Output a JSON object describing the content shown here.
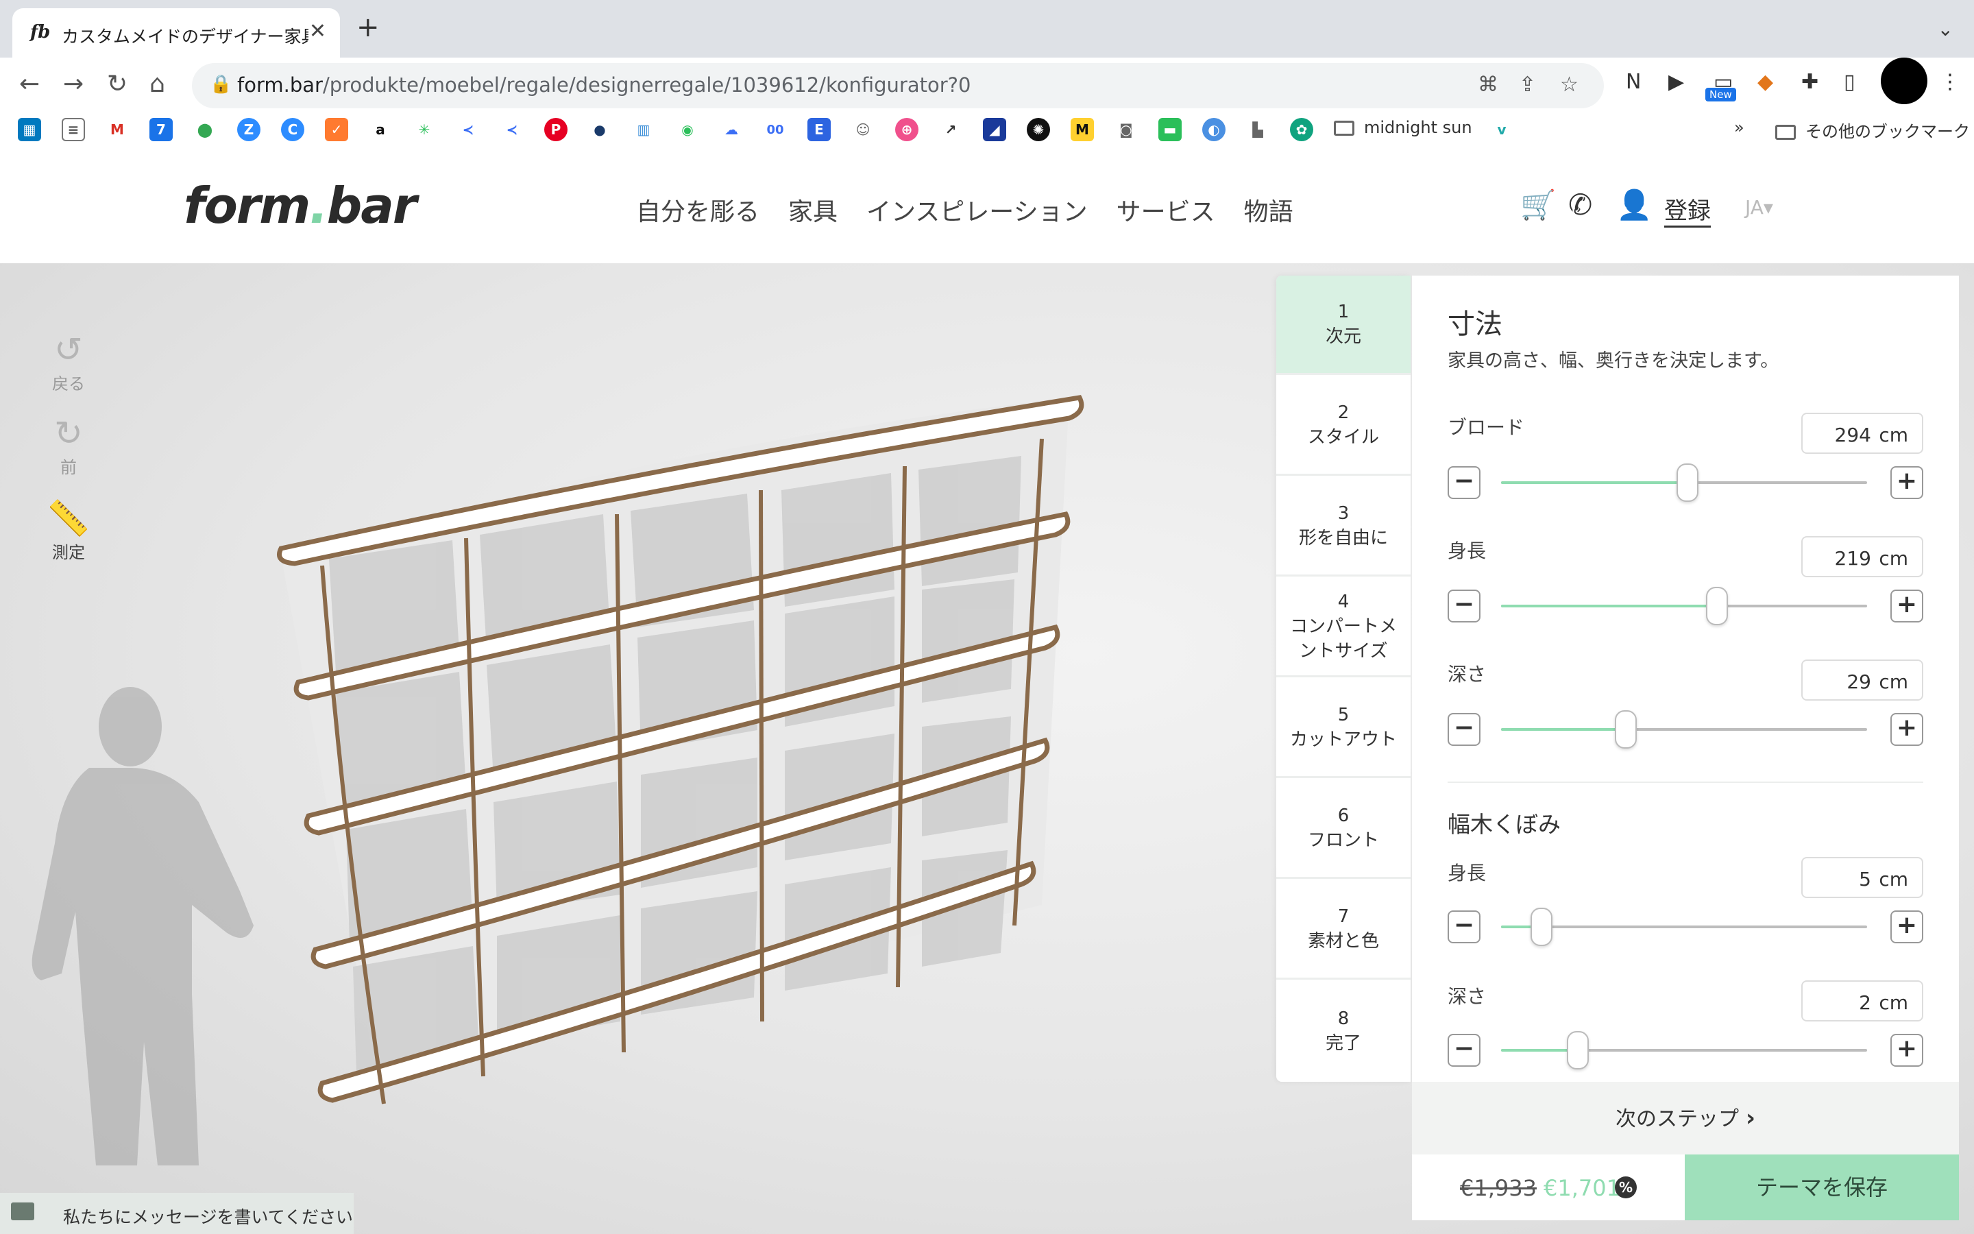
{
  "browser": {
    "tab_title": "カスタムメイドのデザイナー家具の",
    "tab_favicon": "fb",
    "url_host": "form.bar",
    "url_path": "/produkte/moebel/regale/designerregale/1039612/konfigurator?0",
    "extension_badge": "New",
    "bookmark_folder": "midnight sun",
    "other_bookmarks": "その他のブックマーク",
    "bookmarks_more": "»",
    "bookmark_00": "00"
  },
  "header": {
    "logo": "formbar",
    "nav": [
      "自分を彫る",
      "家具",
      "インスピレーション",
      "サービス",
      "物語"
    ],
    "register": "登録",
    "lang": "JA"
  },
  "tools": {
    "undo": "戻る",
    "redo": "前",
    "measure": "測定"
  },
  "message_bar": "私たちにメッセージを書いてください",
  "steps": [
    {
      "num": "1",
      "name": "次元"
    },
    {
      "num": "2",
      "name": "スタイル"
    },
    {
      "num": "3",
      "name": "形を自由に"
    },
    {
      "num": "4",
      "name": "コンパートメントサイズ"
    },
    {
      "num": "5",
      "name": "カットアウト"
    },
    {
      "num": "6",
      "name": "フロント"
    },
    {
      "num": "7",
      "name": "素材と色"
    },
    {
      "num": "8",
      "name": "完了"
    }
  ],
  "config": {
    "title": "寸法",
    "description": "家具の高さ、幅、奥行きを決定します。",
    "unit": "cm",
    "fields": [
      {
        "label": "ブロード",
        "value": "294",
        "level": 0.51
      },
      {
        "label": "身長",
        "value": "219",
        "level": 0.59
      },
      {
        "label": "深さ",
        "value": "29",
        "level": 0.34
      }
    ],
    "plinth_title": "幅木くぼみ",
    "plinth_fields": [
      {
        "label": "身長",
        "value": "5",
        "level": 0.11
      },
      {
        "label": "深さ",
        "value": "2",
        "level": 0.21
      }
    ]
  },
  "footer": {
    "next_step": "次のステップ",
    "old_price": "€1,933",
    "new_price": "€1,701",
    "discount_icon": "%",
    "save_button": "テーマを保存"
  },
  "colors": {
    "accent": "#8fdcb0",
    "active_step": "#d9f1e3",
    "save_button": "#9fe0bb",
    "shelf_edge": "#8a6a4a"
  }
}
